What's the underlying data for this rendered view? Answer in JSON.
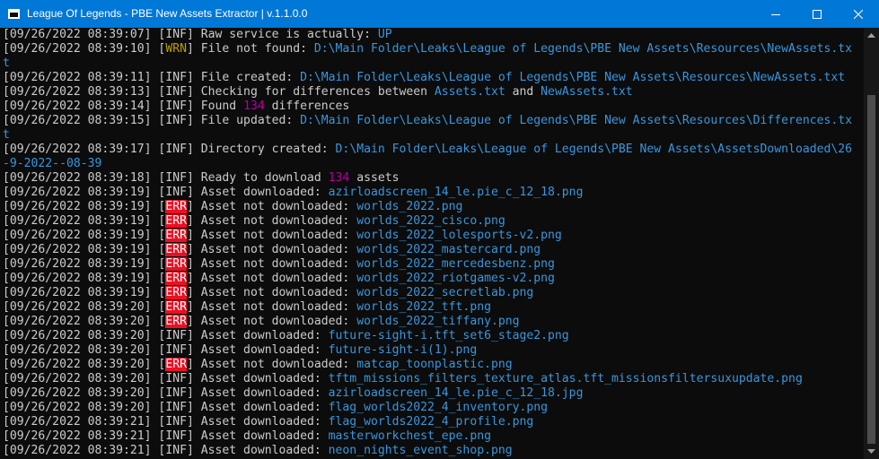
{
  "window": {
    "title": "League Of Legends - PBE New Assets Extractor | v.1.1.0.0",
    "minimize": "—",
    "maximize": "☐",
    "close": "✕"
  },
  "scrollbar": {
    "position": 1.0,
    "visible_fraction": 0.87
  },
  "colors": {
    "titlebar": "#0078d7",
    "console_bg": "#0c0c0c",
    "text": "#cccccc",
    "path": "#3a96dd",
    "number": "#b4009e",
    "warn": "#c19c00",
    "error_bg": "#e81123"
  },
  "lines": [
    {
      "ts": "[09/26/2022 08:39:07]",
      "lvl": "INF",
      "text": " Raw service is actually: ",
      "value": "UP",
      "vclass": "v-cyan"
    },
    {
      "ts": "[09/26/2022 08:39:10]",
      "lvl": "WRN",
      "text": " File not found: ",
      "value": "D:\\Main Folder\\Leaks\\League of Legends\\PBE New Assets\\Resources\\NewAssets.tx",
      "vclass": "v-path"
    },
    {
      "ts": "",
      "lvl": "",
      "text": "",
      "value": "t",
      "vclass": "v-path",
      "cont": true
    },
    {
      "ts": "[09/26/2022 08:39:11]",
      "lvl": "INF",
      "text": " File created: ",
      "value": "D:\\Main Folder\\Leaks\\League of Legends\\PBE New Assets\\Resources\\NewAssets.txt",
      "vclass": "v-path"
    },
    {
      "ts": "[09/26/2022 08:39:13]",
      "lvl": "INF",
      "text": " Checking for differences between ",
      "value": "Assets.txt",
      "vclass": "v-path",
      "text2": " and ",
      "value2": "NewAssets.txt",
      "vclass2": "v-path"
    },
    {
      "ts": "[09/26/2022 08:39:14]",
      "lvl": "INF",
      "text": " Found ",
      "value": "134",
      "vclass": "v-magenta",
      "text2": " differences"
    },
    {
      "ts": "[09/26/2022 08:39:15]",
      "lvl": "INF",
      "text": " File updated: ",
      "value": "D:\\Main Folder\\Leaks\\League of Legends\\PBE New Assets\\Resources\\Differences.tx",
      "vclass": "v-path"
    },
    {
      "ts": "",
      "lvl": "",
      "text": "",
      "value": "t",
      "vclass": "v-path",
      "cont": true
    },
    {
      "ts": "[09/26/2022 08:39:17]",
      "lvl": "INF",
      "text": " Directory created: ",
      "value": "D:\\Main Folder\\Leaks\\League of Legends\\PBE New Assets\\AssetsDownloaded\\26",
      "vclass": "v-path"
    },
    {
      "ts": "",
      "lvl": "",
      "text": "",
      "value": "-9-2022--08-39",
      "vclass": "v-path",
      "cont": true
    },
    {
      "ts": "[09/26/2022 08:39:18]",
      "lvl": "INF",
      "text": " Ready to download ",
      "value": "134",
      "vclass": "v-magenta",
      "text2": " assets"
    },
    {
      "ts": "[09/26/2022 08:39:19]",
      "lvl": "INF",
      "text": " Asset downloaded: ",
      "value": "azirloadscreen_14_le.pie_c_12_18.png",
      "vclass": "v-path"
    },
    {
      "ts": "[09/26/2022 08:39:19]",
      "lvl": "ERR",
      "text": " Asset not downloaded: ",
      "value": "worlds_2022.png",
      "vclass": "v-path"
    },
    {
      "ts": "[09/26/2022 08:39:19]",
      "lvl": "ERR",
      "text": " Asset not downloaded: ",
      "value": "worlds_2022_cisco.png",
      "vclass": "v-path"
    },
    {
      "ts": "[09/26/2022 08:39:19]",
      "lvl": "ERR",
      "text": " Asset not downloaded: ",
      "value": "worlds_2022_lolesports-v2.png",
      "vclass": "v-path"
    },
    {
      "ts": "[09/26/2022 08:39:19]",
      "lvl": "ERR",
      "text": " Asset not downloaded: ",
      "value": "worlds_2022_mastercard.png",
      "vclass": "v-path"
    },
    {
      "ts": "[09/26/2022 08:39:19]",
      "lvl": "ERR",
      "text": " Asset not downloaded: ",
      "value": "worlds_2022_mercedesbenz.png",
      "vclass": "v-path"
    },
    {
      "ts": "[09/26/2022 08:39:19]",
      "lvl": "ERR",
      "text": " Asset not downloaded: ",
      "value": "worlds_2022_riotgames-v2.png",
      "vclass": "v-path"
    },
    {
      "ts": "[09/26/2022 08:39:19]",
      "lvl": "ERR",
      "text": " Asset not downloaded: ",
      "value": "worlds_2022_secretlab.png",
      "vclass": "v-path"
    },
    {
      "ts": "[09/26/2022 08:39:20]",
      "lvl": "ERR",
      "text": " Asset not downloaded: ",
      "value": "worlds_2022_tft.png",
      "vclass": "v-path"
    },
    {
      "ts": "[09/26/2022 08:39:20]",
      "lvl": "ERR",
      "text": " Asset not downloaded: ",
      "value": "worlds_2022_tiffany.png",
      "vclass": "v-path"
    },
    {
      "ts": "[09/26/2022 08:39:20]",
      "lvl": "INF",
      "text": " Asset downloaded: ",
      "value": "future-sight-i.tft_set6_stage2.png",
      "vclass": "v-path"
    },
    {
      "ts": "[09/26/2022 08:39:20]",
      "lvl": "INF",
      "text": " Asset downloaded: ",
      "value": "future-sight-i(1).png",
      "vclass": "v-path"
    },
    {
      "ts": "[09/26/2022 08:39:20]",
      "lvl": "ERR",
      "text": " Asset not downloaded: ",
      "value": "matcap_toonplastic.png",
      "vclass": "v-path"
    },
    {
      "ts": "[09/26/2022 08:39:20]",
      "lvl": "INF",
      "text": " Asset downloaded: ",
      "value": "tftm_missions_filters_texture_atlas.tft_missionsfiltersuxupdate.png",
      "vclass": "v-path"
    },
    {
      "ts": "[09/26/2022 08:39:20]",
      "lvl": "INF",
      "text": " Asset downloaded: ",
      "value": "azirloadscreen_14_le.pie_c_12_18.jpg",
      "vclass": "v-path"
    },
    {
      "ts": "[09/26/2022 08:39:20]",
      "lvl": "INF",
      "text": " Asset downloaded: ",
      "value": "flag_worlds2022_4_inventory.png",
      "vclass": "v-path"
    },
    {
      "ts": "[09/26/2022 08:39:21]",
      "lvl": "INF",
      "text": " Asset downloaded: ",
      "value": "flag_worlds2022_4_profile.png",
      "vclass": "v-path"
    },
    {
      "ts": "[09/26/2022 08:39:21]",
      "lvl": "INF",
      "text": " Asset downloaded: ",
      "value": "masterworkchest_epe.png",
      "vclass": "v-path"
    },
    {
      "ts": "[09/26/2022 08:39:21]",
      "lvl": "INF",
      "text": " Asset downloaded: ",
      "value": "neon_nights_event_shop.png",
      "vclass": "v-path"
    }
  ]
}
